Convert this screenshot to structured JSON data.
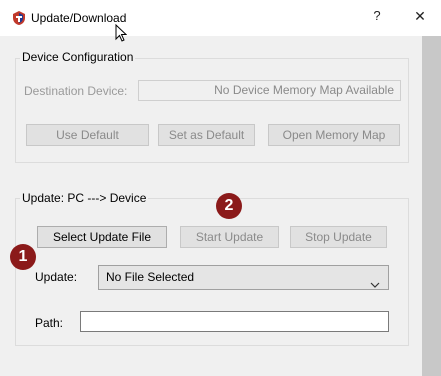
{
  "window": {
    "title": "Update/Download",
    "help_label": "?",
    "close_label": "✕"
  },
  "device_config": {
    "group_label": "Device Configuration",
    "destination_label": "Destination Device:",
    "destination_value": "No Device Memory Map Available",
    "use_default_label": "Use Default",
    "set_default_label": "Set as Default",
    "open_map_label": "Open Memory Map"
  },
  "update_section": {
    "group_label": "Update: PC ---> Device",
    "select_file_label": "Select Update File",
    "start_update_label": "Start Update",
    "stop_update_label": "Stop Update",
    "update_label": "Update:",
    "update_selected": "No File Selected",
    "path_label": "Path:",
    "path_value": ""
  },
  "annotations": {
    "badge_1": "1",
    "badge_2": "2",
    "badge_color": "#8b1a1a"
  },
  "icons": {
    "app": "app-logo-icon",
    "cursor": "mouse-cursor-icon",
    "dropdown": "chevron-down-icon"
  }
}
